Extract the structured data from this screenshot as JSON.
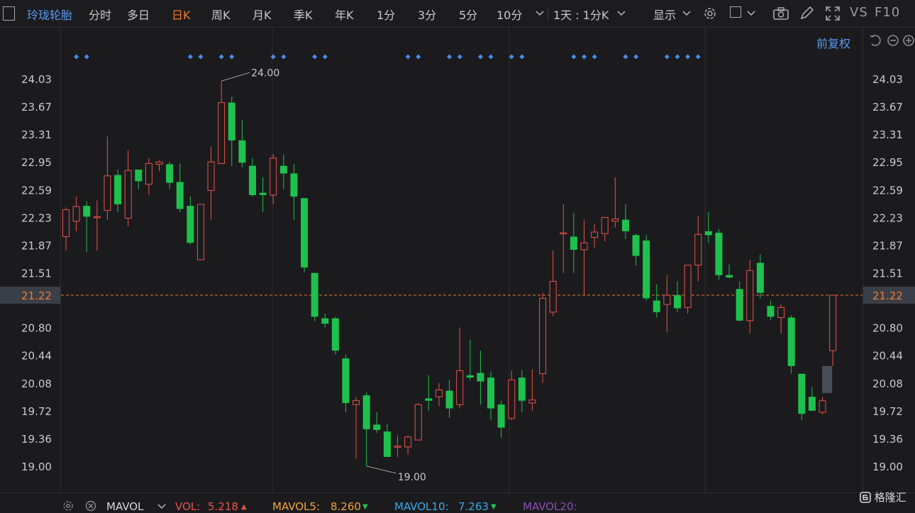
{
  "toolbar": {
    "title": "玲珑轮胎",
    "tabs": [
      "分时",
      "多日",
      "日K",
      "周K",
      "月K",
      "季K",
      "年K",
      "1分",
      "3分",
      "5分",
      "10分"
    ],
    "active_tab": "日K",
    "period_select": "1天 : 1分K",
    "display_label": "显示",
    "vs_label": "VS",
    "f10_label": "F10",
    "chevron_icon": "chevron-down-icon",
    "icons": [
      "gear-icon",
      "square-icon",
      "camera-icon",
      "pencil-icon",
      "fullscreen-icon"
    ]
  },
  "adjust_label": "前复权",
  "last_price": "21.22",
  "bottom": {
    "indicator": "MAVOL",
    "vol_label": "VOL:",
    "vol_value": "5.218",
    "mavol5_label": "MAVOL5:",
    "mavol5_value": "8.260",
    "mavol10_label": "MAVOL10:",
    "mavol10_value": "7.263",
    "mavol20_label": "MAVOL20:"
  },
  "brand": "格隆汇",
  "colors": {
    "up": "#e8524a",
    "down": "#1ec14d",
    "accent": "#f27a2c",
    "link": "#5b9bf2",
    "marker": "#4a8de8"
  },
  "chart_data": {
    "type": "candlestick",
    "ylim": [
      18.8,
      24.25
    ],
    "y_ticks": [
      "24.03",
      "23.67",
      "23.31",
      "22.95",
      "22.59",
      "22.23",
      "21.87",
      "21.51",
      "21.22",
      "20.80",
      "20.44",
      "20.08",
      "19.72",
      "19.36",
      "19.00"
    ],
    "annotations": [
      {
        "label": "24.00",
        "value": 24.0
      },
      {
        "label": "19.00",
        "value": 19.0
      }
    ],
    "current_price": 21.22,
    "marker_groups": [
      [
        1,
        2
      ],
      [
        12,
        13
      ],
      [
        15,
        16
      ],
      [
        20,
        21
      ],
      [
        24,
        25
      ],
      [
        33,
        34
      ],
      [
        37,
        38
      ],
      [
        40,
        41
      ],
      [
        43,
        44
      ],
      [
        49,
        50,
        51
      ],
      [
        54,
        55
      ],
      [
        58,
        59,
        60,
        61
      ]
    ],
    "candles": [
      {
        "o": 21.98,
        "h": 22.36,
        "l": 21.8,
        "c": 22.33
      },
      {
        "o": 22.18,
        "h": 22.5,
        "l": 22.05,
        "c": 22.37
      },
      {
        "o": 22.38,
        "h": 22.44,
        "l": 21.78,
        "c": 22.24
      },
      {
        "o": 22.24,
        "h": 22.45,
        "l": 21.8,
        "c": 22.24
      },
      {
        "o": 22.32,
        "h": 23.28,
        "l": 22.2,
        "c": 22.77
      },
      {
        "o": 22.78,
        "h": 22.85,
        "l": 22.3,
        "c": 22.4
      },
      {
        "o": 22.22,
        "h": 23.1,
        "l": 22.12,
        "c": 22.84
      },
      {
        "o": 22.85,
        "h": 22.85,
        "l": 22.6,
        "c": 22.7
      },
      {
        "o": 22.66,
        "h": 23.0,
        "l": 22.52,
        "c": 22.93
      },
      {
        "o": 22.92,
        "h": 22.97,
        "l": 22.83,
        "c": 22.95
      },
      {
        "o": 22.92,
        "h": 22.95,
        "l": 22.6,
        "c": 22.68
      },
      {
        "o": 22.69,
        "h": 22.93,
        "l": 22.3,
        "c": 22.34
      },
      {
        "o": 22.38,
        "h": 22.5,
        "l": 21.88,
        "c": 21.9
      },
      {
        "o": 21.68,
        "h": 22.4,
        "l": 21.68,
        "c": 22.4
      },
      {
        "o": 22.58,
        "h": 23.15,
        "l": 22.2,
        "c": 22.95
      },
      {
        "o": 22.93,
        "h": 24.0,
        "l": 22.93,
        "c": 23.72
      },
      {
        "o": 23.72,
        "h": 23.8,
        "l": 22.9,
        "c": 23.23
      },
      {
        "o": 23.23,
        "h": 23.5,
        "l": 22.88,
        "c": 22.94
      },
      {
        "o": 22.9,
        "h": 23.0,
        "l": 22.5,
        "c": 22.52
      },
      {
        "o": 22.55,
        "h": 22.75,
        "l": 22.3,
        "c": 22.52
      },
      {
        "o": 22.52,
        "h": 23.05,
        "l": 22.4,
        "c": 23.0
      },
      {
        "o": 22.9,
        "h": 23.05,
        "l": 22.6,
        "c": 22.8
      },
      {
        "o": 22.8,
        "h": 22.92,
        "l": 22.2,
        "c": 22.5
      },
      {
        "o": 22.48,
        "h": 22.48,
        "l": 21.52,
        "c": 21.58
      },
      {
        "o": 21.51,
        "h": 21.51,
        "l": 20.88,
        "c": 20.94
      },
      {
        "o": 20.92,
        "h": 20.98,
        "l": 20.8,
        "c": 20.85
      },
      {
        "o": 20.92,
        "h": 20.94,
        "l": 20.45,
        "c": 20.5
      },
      {
        "o": 20.4,
        "h": 20.45,
        "l": 19.7,
        "c": 19.82
      },
      {
        "o": 19.8,
        "h": 19.9,
        "l": 19.1,
        "c": 19.85
      },
      {
        "o": 19.92,
        "h": 19.96,
        "l": 19.0,
        "c": 19.48
      },
      {
        "o": 19.54,
        "h": 19.7,
        "l": 19.43,
        "c": 19.47
      },
      {
        "o": 19.45,
        "h": 19.55,
        "l": 19.2,
        "c": 19.12
      },
      {
        "o": 19.25,
        "h": 19.4,
        "l": 19.12,
        "c": 19.26
      },
      {
        "o": 19.25,
        "h": 19.4,
        "l": 19.15,
        "c": 19.38
      },
      {
        "o": 19.34,
        "h": 19.82,
        "l": 19.34,
        "c": 19.8
      },
      {
        "o": 19.88,
        "h": 20.18,
        "l": 19.72,
        "c": 19.85
      },
      {
        "o": 19.9,
        "h": 20.08,
        "l": 19.78,
        "c": 19.99
      },
      {
        "o": 19.98,
        "h": 20.12,
        "l": 19.63,
        "c": 19.75
      },
      {
        "o": 19.8,
        "h": 20.8,
        "l": 19.75,
        "c": 20.24
      },
      {
        "o": 20.18,
        "h": 20.64,
        "l": 20.12,
        "c": 20.15
      },
      {
        "o": 20.21,
        "h": 20.5,
        "l": 19.8,
        "c": 20.1
      },
      {
        "o": 20.15,
        "h": 20.23,
        "l": 19.6,
        "c": 19.75
      },
      {
        "o": 19.8,
        "h": 19.85,
        "l": 19.37,
        "c": 19.5
      },
      {
        "o": 19.62,
        "h": 20.24,
        "l": 19.6,
        "c": 20.12
      },
      {
        "o": 20.15,
        "h": 20.25,
        "l": 19.7,
        "c": 19.85
      },
      {
        "o": 19.82,
        "h": 20.26,
        "l": 19.72,
        "c": 19.86
      },
      {
        "o": 20.2,
        "h": 21.25,
        "l": 20.08,
        "c": 21.18
      },
      {
        "o": 21.0,
        "h": 21.8,
        "l": 20.95,
        "c": 21.4
      },
      {
        "o": 22.03,
        "h": 22.4,
        "l": 21.51,
        "c": 22.03
      },
      {
        "o": 21.98,
        "h": 22.29,
        "l": 21.51,
        "c": 21.81
      },
      {
        "o": 21.81,
        "h": 22.2,
        "l": 21.22,
        "c": 21.9
      },
      {
        "o": 21.97,
        "h": 22.15,
        "l": 21.84,
        "c": 22.04
      },
      {
        "o": 22.02,
        "h": 22.2,
        "l": 21.92,
        "c": 22.23
      },
      {
        "o": 22.18,
        "h": 22.75,
        "l": 22.1,
        "c": 22.21
      },
      {
        "o": 22.2,
        "h": 22.4,
        "l": 21.95,
        "c": 22.05
      },
      {
        "o": 22.0,
        "h": 22.02,
        "l": 21.6,
        "c": 21.73
      },
      {
        "o": 21.93,
        "h": 22.0,
        "l": 21.15,
        "c": 21.18
      },
      {
        "o": 21.15,
        "h": 21.36,
        "l": 20.93,
        "c": 21.0
      },
      {
        "o": 21.1,
        "h": 21.48,
        "l": 20.74,
        "c": 21.22
      },
      {
        "o": 21.22,
        "h": 21.4,
        "l": 21.0,
        "c": 21.05
      },
      {
        "o": 21.06,
        "h": 21.6,
        "l": 20.98,
        "c": 21.61
      },
      {
        "o": 21.61,
        "h": 22.25,
        "l": 21.4,
        "c": 22.01
      },
      {
        "o": 22.05,
        "h": 22.3,
        "l": 21.9,
        "c": 22.0
      },
      {
        "o": 22.03,
        "h": 22.08,
        "l": 21.42,
        "c": 21.48
      },
      {
        "o": 21.48,
        "h": 21.62,
        "l": 21.44,
        "c": 21.45
      },
      {
        "o": 21.3,
        "h": 21.4,
        "l": 20.88,
        "c": 20.89
      },
      {
        "o": 20.89,
        "h": 21.68,
        "l": 20.72,
        "c": 21.54
      },
      {
        "o": 21.64,
        "h": 21.75,
        "l": 21.18,
        "c": 21.25
      },
      {
        "o": 21.08,
        "h": 21.15,
        "l": 20.9,
        "c": 20.94
      },
      {
        "o": 20.93,
        "h": 21.1,
        "l": 20.72,
        "c": 21.06
      },
      {
        "o": 20.93,
        "h": 20.96,
        "l": 20.2,
        "c": 20.3
      },
      {
        "o": 20.2,
        "h": 20.2,
        "l": 19.6,
        "c": 19.68
      },
      {
        "o": 19.9,
        "h": 20.03,
        "l": 19.72,
        "c": 19.72
      },
      {
        "o": 19.7,
        "h": 19.9,
        "l": 19.67,
        "c": 19.85
      },
      {
        "o": 20.5,
        "h": 21.22,
        "l": 20.3,
        "c": 21.22
      }
    ]
  }
}
